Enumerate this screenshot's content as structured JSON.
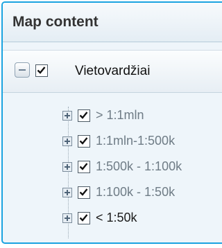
{
  "panel": {
    "title": "Map content",
    "accent_color": "#1aa3e0"
  },
  "group": {
    "label": "Vietovardžiai",
    "checked": true,
    "expanded": true,
    "collapse_icon": "minus-icon"
  },
  "layers": [
    {
      "label": "> 1:1mln",
      "checked": true,
      "active": false,
      "expand_icon": "plus-icon"
    },
    {
      "label": "1:1mln-1:500k",
      "checked": true,
      "active": false,
      "expand_icon": "plus-icon"
    },
    {
      "label": "1:500k - 1:100k",
      "checked": true,
      "active": false,
      "expand_icon": "plus-icon"
    },
    {
      "label": "1:100k - 1:50k",
      "checked": true,
      "active": false,
      "expand_icon": "plus-icon"
    },
    {
      "label": "< 1:50k",
      "checked": true,
      "active": true,
      "expand_icon": "plus-icon"
    }
  ]
}
